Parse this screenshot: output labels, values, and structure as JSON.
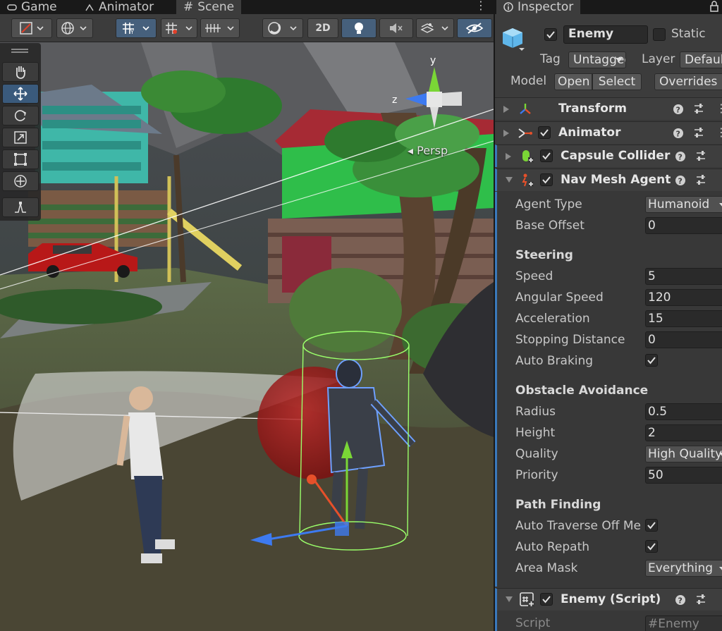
{
  "tabs": {
    "game": "Game",
    "animator": "Animator",
    "scene": "Scene"
  },
  "scene_toolbar": {
    "btn_2d": "2D"
  },
  "viewport": {
    "persp_label": "Persp",
    "axis_y": "y",
    "axis_z": "z"
  },
  "inspector": {
    "tab_label": "Inspector",
    "gameobject": {
      "name": "Enemy",
      "active": true,
      "static_label": "Static",
      "static_checked": false,
      "tag_label": "Tag",
      "tag_value": "Untagged",
      "layer_label": "Layer",
      "layer_value": "Default",
      "model_label": "Model",
      "open_label": "Open",
      "select_label": "Select",
      "overrides_label": "Overrides"
    },
    "components": {
      "transform": "Transform",
      "animator": "Animator",
      "capsule_collider": "Capsule Collider",
      "nav_mesh_agent": "Nav Mesh Agent",
      "enemy_script": "Enemy (Script)"
    },
    "nav_mesh_agent": {
      "agent_type_label": "Agent Type",
      "agent_type_value": "Humanoid",
      "base_offset_label": "Base Offset",
      "base_offset_value": "0",
      "steering_header": "Steering",
      "speed_label": "Speed",
      "speed_value": "5",
      "angular_speed_label": "Angular Speed",
      "angular_speed_value": "120",
      "acceleration_label": "Acceleration",
      "acceleration_value": "15",
      "stopping_distance_label": "Stopping Distance",
      "stopping_distance_value": "0",
      "auto_braking_label": "Auto Braking",
      "auto_braking_checked": true,
      "obstacle_header": "Obstacle Avoidance",
      "radius_label": "Radius",
      "radius_value": "0.5",
      "height_label": "Height",
      "height_value": "2",
      "quality_label": "Quality",
      "quality_value": "High Quality",
      "priority_label": "Priority",
      "priority_value": "50",
      "pathfinding_header": "Path Finding",
      "auto_traverse_label": "Auto Traverse Off Mesh Link",
      "auto_traverse_checked": true,
      "auto_repath_label": "Auto Repath",
      "auto_repath_checked": true,
      "area_mask_label": "Area Mask",
      "area_mask_value": "Everything"
    },
    "enemy_script": {
      "script_label": "Script",
      "script_value": "Enemy"
    }
  },
  "colors": {
    "accent_blue": "#3a79bb",
    "panel_bg": "#383838",
    "header_bg": "#3c3c3c"
  }
}
